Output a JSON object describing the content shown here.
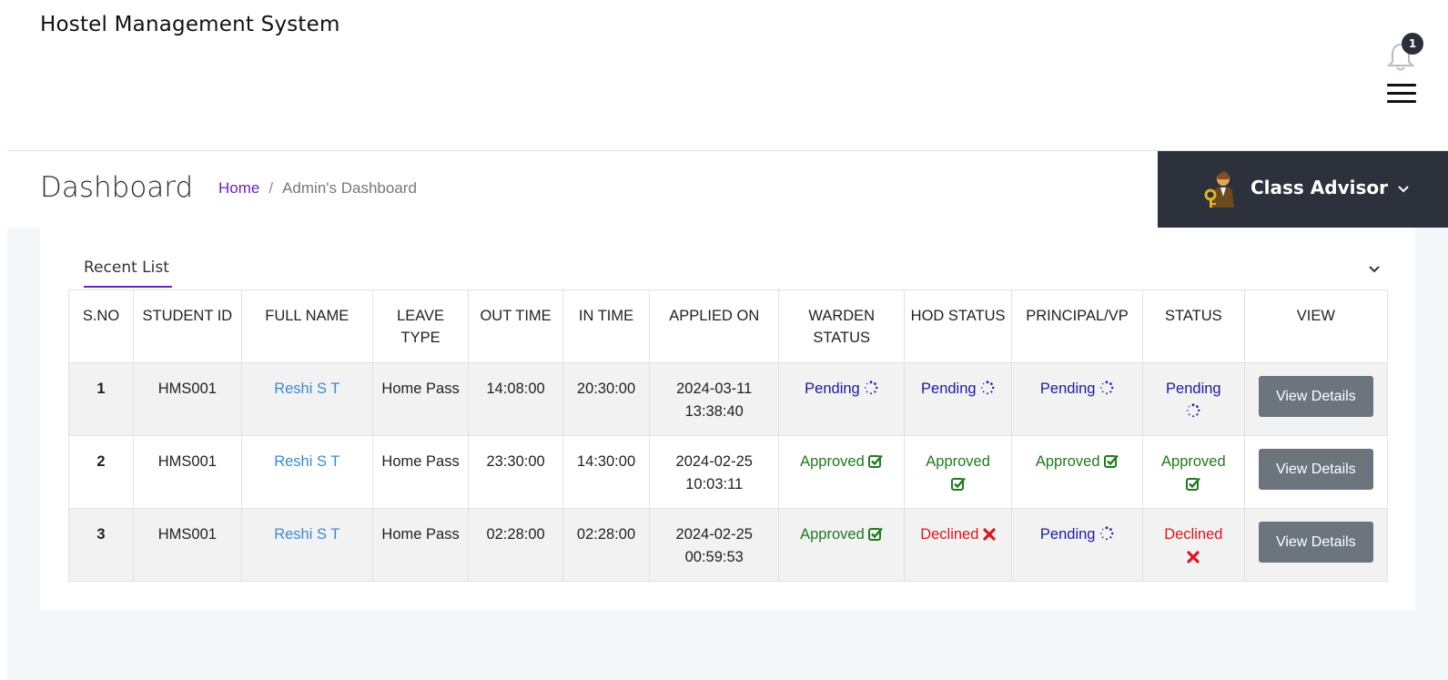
{
  "app": {
    "title": "Hostel Management System"
  },
  "notifications": {
    "count": "1"
  },
  "page": {
    "title": "Dashboard"
  },
  "breadcrumb": {
    "home": "Home",
    "separator": "/",
    "current": "Admin's Dashboard"
  },
  "role": {
    "name": "Class Advisor"
  },
  "card": {
    "tab_label": "Recent List"
  },
  "table": {
    "headers": [
      "S.NO",
      "STUDENT ID",
      "FULL NAME",
      "LEAVE TYPE",
      "OUT TIME",
      "IN TIME",
      "APPLIED ON",
      "WARDEN STATUS",
      "HOD STATUS",
      "PRINCIPAL/VP",
      "STATUS",
      "VIEW"
    ],
    "rows": [
      {
        "sno": "1",
        "student_id": "HMS001",
        "full_name": "Reshi S T",
        "leave_type": "Home Pass",
        "out_time": "14:08:00",
        "in_time": "20:30:00",
        "applied_on": "2024-03-11 13:38:40",
        "warden": "Pending",
        "hod": "Pending",
        "principal": "Pending",
        "status": "Pending",
        "view": "View Details"
      },
      {
        "sno": "2",
        "student_id": "HMS001",
        "full_name": "Reshi S T",
        "leave_type": "Home Pass",
        "out_time": "23:30:00",
        "in_time": "14:30:00",
        "applied_on": "2024-02-25 10:03:11",
        "warden": "Approved",
        "hod": "Approved",
        "principal": "Approved",
        "status": "Approved",
        "view": "View Details"
      },
      {
        "sno": "3",
        "student_id": "HMS001",
        "full_name": "Reshi S T",
        "leave_type": "Home Pass",
        "out_time": "02:28:00",
        "in_time": "02:28:00",
        "applied_on": "2024-02-25 00:59:53",
        "warden": "Approved",
        "hod": "Declined",
        "principal": "Pending",
        "status": "Declined",
        "view": "View Details"
      }
    ]
  },
  "icons": {
    "pending": "spinner-icon",
    "approved": "check-square-icon",
    "declined": "x-mark-icon",
    "bell": "bell-icon",
    "menu": "hamburger-icon",
    "chevron": "chevron-down-icon",
    "avatar": "user-key-avatar-icon"
  },
  "colors": {
    "accent": "#6b21c8",
    "pending": "#1a1aa6",
    "approved": "#1f7a1f",
    "declined": "#e0141e",
    "role_bg": "#2c313b",
    "button": "#6c757d",
    "link": "#3a8ad6"
  }
}
